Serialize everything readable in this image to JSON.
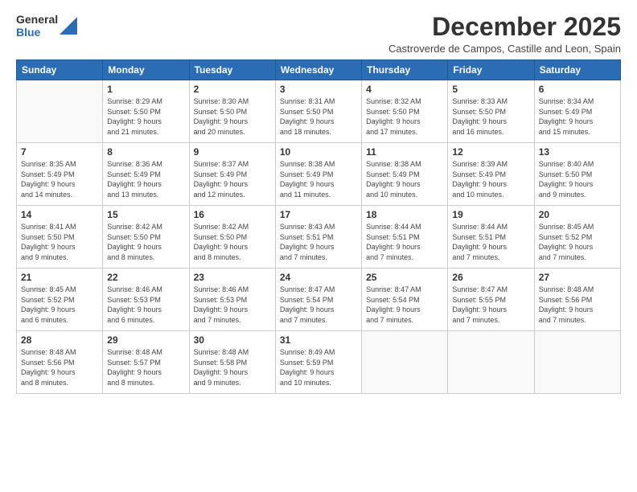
{
  "header": {
    "logo_general": "General",
    "logo_blue": "Blue",
    "month_title": "December 2025",
    "location": "Castroverde de Campos, Castille and Leon, Spain"
  },
  "weekdays": [
    "Sunday",
    "Monday",
    "Tuesday",
    "Wednesday",
    "Thursday",
    "Friday",
    "Saturday"
  ],
  "weeks": [
    [
      {
        "day": "",
        "info": ""
      },
      {
        "day": "1",
        "info": "Sunrise: 8:29 AM\nSunset: 5:50 PM\nDaylight: 9 hours\nand 21 minutes."
      },
      {
        "day": "2",
        "info": "Sunrise: 8:30 AM\nSunset: 5:50 PM\nDaylight: 9 hours\nand 20 minutes."
      },
      {
        "day": "3",
        "info": "Sunrise: 8:31 AM\nSunset: 5:50 PM\nDaylight: 9 hours\nand 18 minutes."
      },
      {
        "day": "4",
        "info": "Sunrise: 8:32 AM\nSunset: 5:50 PM\nDaylight: 9 hours\nand 17 minutes."
      },
      {
        "day": "5",
        "info": "Sunrise: 8:33 AM\nSunset: 5:50 PM\nDaylight: 9 hours\nand 16 minutes."
      },
      {
        "day": "6",
        "info": "Sunrise: 8:34 AM\nSunset: 5:49 PM\nDaylight: 9 hours\nand 15 minutes."
      }
    ],
    [
      {
        "day": "7",
        "info": "Sunrise: 8:35 AM\nSunset: 5:49 PM\nDaylight: 9 hours\nand 14 minutes."
      },
      {
        "day": "8",
        "info": "Sunrise: 8:36 AM\nSunset: 5:49 PM\nDaylight: 9 hours\nand 13 minutes."
      },
      {
        "day": "9",
        "info": "Sunrise: 8:37 AM\nSunset: 5:49 PM\nDaylight: 9 hours\nand 12 minutes."
      },
      {
        "day": "10",
        "info": "Sunrise: 8:38 AM\nSunset: 5:49 PM\nDaylight: 9 hours\nand 11 minutes."
      },
      {
        "day": "11",
        "info": "Sunrise: 8:38 AM\nSunset: 5:49 PM\nDaylight: 9 hours\nand 10 minutes."
      },
      {
        "day": "12",
        "info": "Sunrise: 8:39 AM\nSunset: 5:49 PM\nDaylight: 9 hours\nand 10 minutes."
      },
      {
        "day": "13",
        "info": "Sunrise: 8:40 AM\nSunset: 5:50 PM\nDaylight: 9 hours\nand 9 minutes."
      }
    ],
    [
      {
        "day": "14",
        "info": "Sunrise: 8:41 AM\nSunset: 5:50 PM\nDaylight: 9 hours\nand 9 minutes."
      },
      {
        "day": "15",
        "info": "Sunrise: 8:42 AM\nSunset: 5:50 PM\nDaylight: 9 hours\nand 8 minutes."
      },
      {
        "day": "16",
        "info": "Sunrise: 8:42 AM\nSunset: 5:50 PM\nDaylight: 9 hours\nand 8 minutes."
      },
      {
        "day": "17",
        "info": "Sunrise: 8:43 AM\nSunset: 5:51 PM\nDaylight: 9 hours\nand 7 minutes."
      },
      {
        "day": "18",
        "info": "Sunrise: 8:44 AM\nSunset: 5:51 PM\nDaylight: 9 hours\nand 7 minutes."
      },
      {
        "day": "19",
        "info": "Sunrise: 8:44 AM\nSunset: 5:51 PM\nDaylight: 9 hours\nand 7 minutes."
      },
      {
        "day": "20",
        "info": "Sunrise: 8:45 AM\nSunset: 5:52 PM\nDaylight: 9 hours\nand 7 minutes."
      }
    ],
    [
      {
        "day": "21",
        "info": "Sunrise: 8:45 AM\nSunset: 5:52 PM\nDaylight: 9 hours\nand 6 minutes."
      },
      {
        "day": "22",
        "info": "Sunrise: 8:46 AM\nSunset: 5:53 PM\nDaylight: 9 hours\nand 6 minutes."
      },
      {
        "day": "23",
        "info": "Sunrise: 8:46 AM\nSunset: 5:53 PM\nDaylight: 9 hours\nand 7 minutes."
      },
      {
        "day": "24",
        "info": "Sunrise: 8:47 AM\nSunset: 5:54 PM\nDaylight: 9 hours\nand 7 minutes."
      },
      {
        "day": "25",
        "info": "Sunrise: 8:47 AM\nSunset: 5:54 PM\nDaylight: 9 hours\nand 7 minutes."
      },
      {
        "day": "26",
        "info": "Sunrise: 8:47 AM\nSunset: 5:55 PM\nDaylight: 9 hours\nand 7 minutes."
      },
      {
        "day": "27",
        "info": "Sunrise: 8:48 AM\nSunset: 5:56 PM\nDaylight: 9 hours\nand 7 minutes."
      }
    ],
    [
      {
        "day": "28",
        "info": "Sunrise: 8:48 AM\nSunset: 5:56 PM\nDaylight: 9 hours\nand 8 minutes."
      },
      {
        "day": "29",
        "info": "Sunrise: 8:48 AM\nSunset: 5:57 PM\nDaylight: 9 hours\nand 8 minutes."
      },
      {
        "day": "30",
        "info": "Sunrise: 8:48 AM\nSunset: 5:58 PM\nDaylight: 9 hours\nand 9 minutes."
      },
      {
        "day": "31",
        "info": "Sunrise: 8:49 AM\nSunset: 5:59 PM\nDaylight: 9 hours\nand 10 minutes."
      },
      {
        "day": "",
        "info": ""
      },
      {
        "day": "",
        "info": ""
      },
      {
        "day": "",
        "info": ""
      }
    ]
  ]
}
